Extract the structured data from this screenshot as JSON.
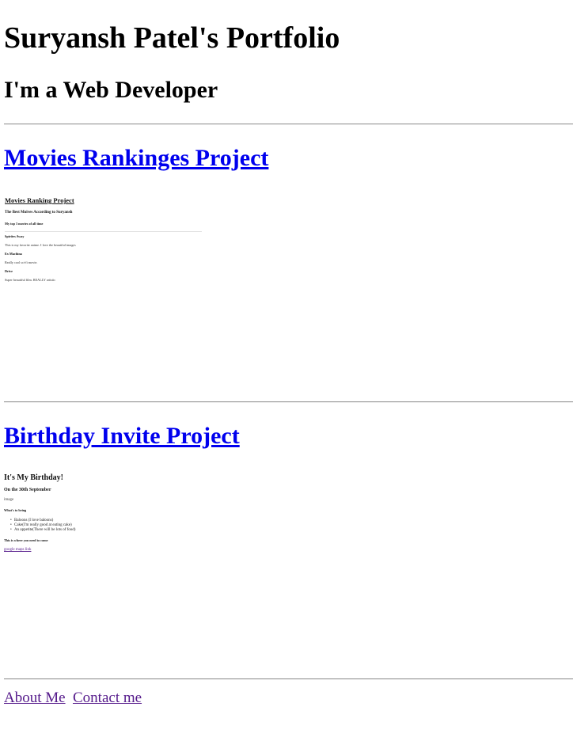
{
  "header": {
    "title": "Suryansh Patel's Portfolio",
    "subtitle": "I'm a Web Developer"
  },
  "projects": [
    {
      "title": "Movies Rankinges Project",
      "preview": {
        "heading": "Movies Ranking Project",
        "subheading": "The Best Moives According to Suryansh",
        "intro": "My top 3 movies of all time",
        "items": [
          {
            "name": "Spirites Away",
            "desc": "This is my favorite anime. I love the beautiful images"
          },
          {
            "name": "Ex Machina",
            "desc": "Really cool sci-fi movie."
          },
          {
            "name": "Drive",
            "desc": "Super beautiful film. REALLY artistic"
          }
        ]
      }
    },
    {
      "title": "Birthday Invite Project",
      "preview": {
        "heading": "It's My Birthday!",
        "date": "On the 30th September",
        "image_alt": "image",
        "bring_heading": "What's to bring",
        "bring_items": [
          "Baloons (I love baloons)",
          "Cake(I'm really good at eating cake)",
          "An appetite(There will be lots of food)"
        ],
        "where_heading": "This is where you need to come",
        "map_link": "google maps link"
      }
    }
  ],
  "footer": {
    "about": "About Me",
    "contact": "Contact me"
  },
  "colors": {
    "link": "#0000ee",
    "visited_link": "#551a8b",
    "divider": "#9a9a9a"
  }
}
